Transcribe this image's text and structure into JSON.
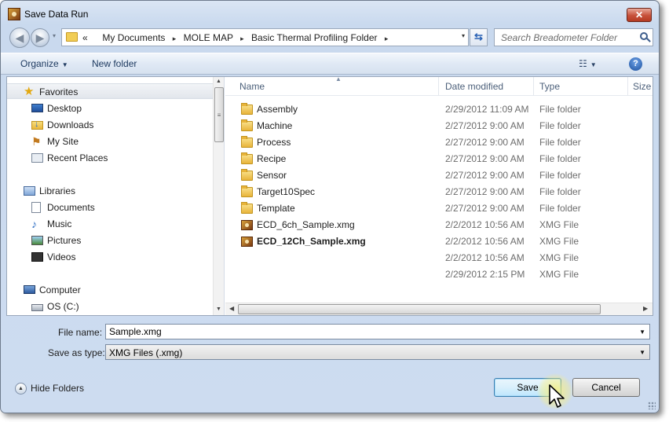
{
  "window": {
    "title": "Save Data Run",
    "close_label": "✕"
  },
  "address": {
    "recent_arrow": "▾",
    "prefix": "«",
    "crumbs": [
      "My Documents",
      "MOLE MAP",
      "Basic Thermal Profiling Folder"
    ],
    "separator": "▸",
    "dropdown": "▾",
    "refresh_label": "⇆"
  },
  "search": {
    "placeholder": "Search Breadometer Folder"
  },
  "toolbar": {
    "organize_label": "Organize",
    "new_folder_label": "New folder",
    "view_label": "☷",
    "help_label": "?"
  },
  "nav_pane": {
    "favorites": {
      "label": "Favorites",
      "items": [
        "Desktop",
        "Downloads",
        "My Site",
        "Recent Places"
      ]
    },
    "libraries": {
      "label": "Libraries",
      "items": [
        "Documents",
        "Music",
        "Pictures",
        "Videos"
      ]
    },
    "computer": {
      "label": "Computer",
      "items": [
        "OS (C:)"
      ]
    }
  },
  "file_list": {
    "columns": [
      "Name",
      "Date modified",
      "Type",
      "Size"
    ],
    "rows": [
      {
        "name": "Assembly",
        "date": "2/29/2012 11:09 AM",
        "type": "File folder",
        "icon": "folder-icon"
      },
      {
        "name": "Machine",
        "date": "2/27/2012 9:00 AM",
        "type": "File folder",
        "icon": "folder-icon"
      },
      {
        "name": "Process",
        "date": "2/27/2012 9:00 AM",
        "type": "File folder",
        "icon": "folder-icon"
      },
      {
        "name": "Recipe",
        "date": "2/27/2012 9:00 AM",
        "type": "File folder",
        "icon": "folder-icon"
      },
      {
        "name": "Sensor",
        "date": "2/27/2012 9:00 AM",
        "type": "File folder",
        "icon": "folder-icon"
      },
      {
        "name": "Target10Spec",
        "date": "2/27/2012 9:00 AM",
        "type": "File folder",
        "icon": "folder-icon"
      },
      {
        "name": "Template",
        "date": "2/27/2012 9:00 AM",
        "type": "File folder",
        "icon": "folder-icon"
      },
      {
        "name": "ECD_6ch_Sample.xmg",
        "date": "2/2/2012 10:56 AM",
        "type": "XMG File",
        "icon": "xmg-file-icon"
      },
      {
        "name": "ECD_12Ch_Sample.xmg",
        "date": "2/2/2012 10:56 AM",
        "type": "XMG File",
        "icon": "xmg-file-icon"
      },
      {
        "name": "",
        "date": "2/2/2012 10:56 AM",
        "type": "XMG File",
        "icon": ""
      },
      {
        "name": "",
        "date": "2/29/2012 2:15 PM",
        "type": "XMG File",
        "icon": ""
      }
    ]
  },
  "form": {
    "file_name_label": "File name:",
    "file_name_value": "Sample.xmg",
    "save_type_label": "Save as type:",
    "save_type_value": "XMG Files (.xmg)"
  },
  "footer": {
    "hide_folders_label": "Hide Folders",
    "save_label": "Save",
    "cancel_label": "Cancel"
  }
}
